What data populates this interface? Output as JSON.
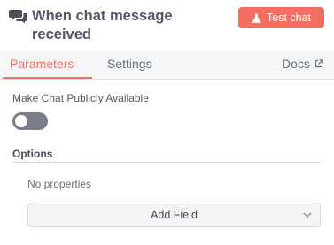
{
  "header": {
    "title": "When chat message received",
    "test_button_label": "Test chat",
    "chat_icon": "chat-bubbles-icon",
    "test_icon": "flask-icon"
  },
  "tabs": {
    "items": [
      {
        "label": "Parameters",
        "active": true
      },
      {
        "label": "Settings",
        "active": false
      }
    ],
    "docs_label": "Docs",
    "docs_icon": "external-link-icon"
  },
  "parameters": {
    "public_label": "Make Chat Publicly Available",
    "public_enabled": false,
    "options_label": "Options",
    "no_properties_text": "No properties",
    "add_field_label": "Add Field",
    "add_field_icon": "chevron-down-icon"
  },
  "colors": {
    "accent": "#f46f61",
    "toggle_off": "#7b7e88"
  }
}
